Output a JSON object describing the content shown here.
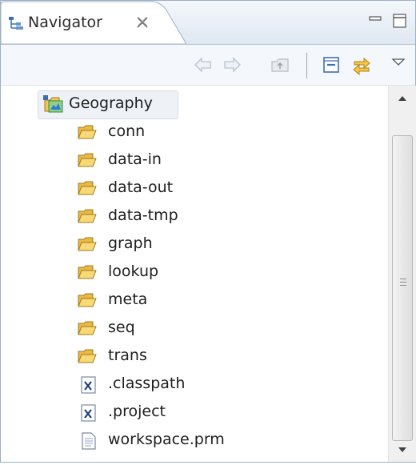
{
  "panel": {
    "tab_label": "Navigator",
    "tab_icon": "navigator-tree-icon",
    "close_icon": "close-icon"
  },
  "window_controls": {
    "minimize_icon": "minimize-icon",
    "maximize_icon": "maximize-icon"
  },
  "toolbar": {
    "buttons": [
      {
        "icon": "back-arrow-icon",
        "enabled": false
      },
      {
        "icon": "forward-arrow-icon",
        "enabled": false
      },
      {
        "icon": "up-folder-icon",
        "enabled": false
      },
      {
        "icon": "collapse-all-icon",
        "enabled": true
      },
      {
        "icon": "link-with-editor-icon",
        "enabled": true
      },
      {
        "icon": "view-menu-icon",
        "enabled": true
      }
    ]
  },
  "tree": {
    "root": {
      "label": "Geography",
      "icon": "project-folder-icon"
    },
    "children": [
      {
        "label": "conn",
        "icon": "folder-icon"
      },
      {
        "label": "data-in",
        "icon": "folder-icon"
      },
      {
        "label": "data-out",
        "icon": "folder-icon"
      },
      {
        "label": "data-tmp",
        "icon": "folder-icon"
      },
      {
        "label": "graph",
        "icon": "folder-icon"
      },
      {
        "label": "lookup",
        "icon": "folder-icon"
      },
      {
        "label": "meta",
        "icon": "folder-icon"
      },
      {
        "label": "seq",
        "icon": "folder-icon"
      },
      {
        "label": "trans",
        "icon": "folder-icon"
      },
      {
        "label": ".classpath",
        "icon": "xml-file-icon"
      },
      {
        "label": ".project",
        "icon": "xml-file-icon"
      },
      {
        "label": "workspace.prm",
        "icon": "text-file-icon"
      }
    ]
  },
  "colors": {
    "folder": "#f3cf6a",
    "accent": "#3d6fb6",
    "border": "#9eb0c6"
  }
}
